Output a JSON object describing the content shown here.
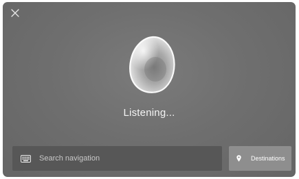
{
  "close": {
    "icon": "close-icon"
  },
  "voice": {
    "orb_icon": "voice-orb",
    "status": "Listening..."
  },
  "search": {
    "icon": "keyboard-icon",
    "placeholder": "Search navigation"
  },
  "destinations": {
    "icon": "location-pin-icon",
    "label": "Destinations"
  },
  "colors": {
    "background": "#6f6f6f",
    "search_bar": "#575757",
    "destinations_button": "#8e8e8e",
    "text": "#f4f4f4"
  }
}
